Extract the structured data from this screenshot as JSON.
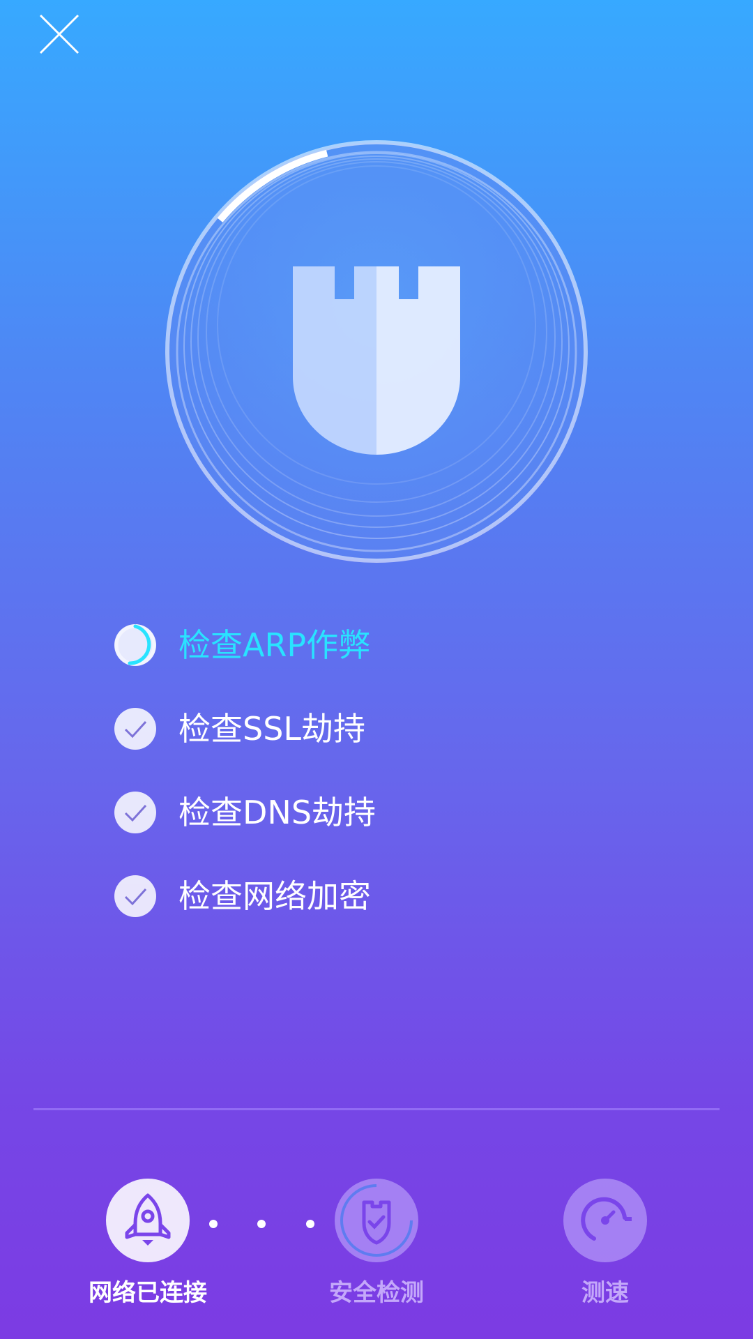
{
  "header": {
    "close_icon": "close-icon"
  },
  "scan": {
    "progress": 0.1,
    "icon": "castle-shield-icon"
  },
  "checks": [
    {
      "label": "检查ARP作弊",
      "status": "checking"
    },
    {
      "label": "检查SSL劫持",
      "status": "done"
    },
    {
      "label": "检查DNS劫持",
      "status": "done"
    },
    {
      "label": "检查网络加密",
      "status": "done"
    }
  ],
  "steps": [
    {
      "label": "网络已连接",
      "icon": "rocket-icon",
      "state": "done"
    },
    {
      "label": "安全检测",
      "icon": "shield-check-icon",
      "state": "active"
    },
    {
      "label": "测速",
      "icon": "speedometer-icon",
      "state": "pending"
    }
  ],
  "colors": {
    "active_check": "#29e3ff",
    "step_icon": "#7a45ea",
    "background_top": "#37a9ff",
    "background_bottom": "#7c3be3"
  }
}
